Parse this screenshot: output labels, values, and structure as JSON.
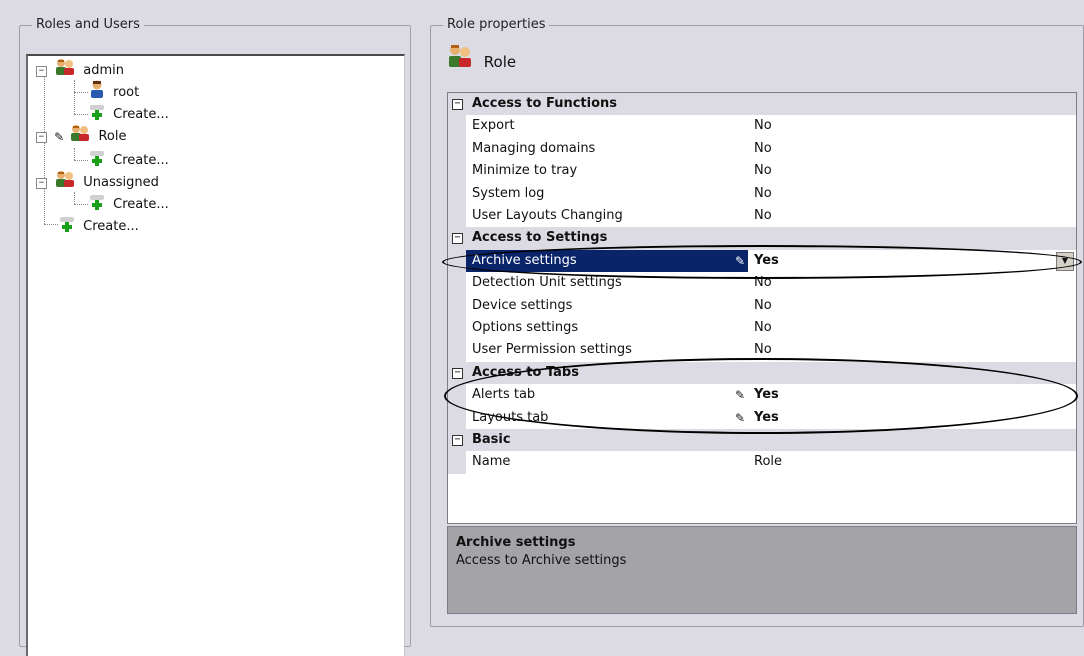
{
  "roles_panel": {
    "title": "Roles and Users",
    "tree": [
      {
        "id": "admin",
        "label": "admin",
        "icon": "users-group-icon",
        "expander": "minus"
      },
      {
        "id": "root",
        "label": "root",
        "icon": "user-icon"
      },
      {
        "id": "admin_create",
        "label": "Create...",
        "icon": "add-user-icon"
      },
      {
        "id": "role",
        "label": "Role",
        "icon": "users-group-icon",
        "expander": "minus",
        "edit_icon": "pencil-icon"
      },
      {
        "id": "role_create",
        "label": "Create...",
        "icon": "add-user-icon"
      },
      {
        "id": "unassigned",
        "label": "Unassigned",
        "icon": "users-group-icon",
        "expander": "minus"
      },
      {
        "id": "unassigned_create",
        "label": "Create...",
        "icon": "add-user-icon"
      },
      {
        "id": "root_create",
        "label": "Create...",
        "icon": "add-user-icon"
      }
    ]
  },
  "props_panel": {
    "title": "Role properties",
    "header": {
      "label": "Role",
      "icon": "users-group-icon"
    },
    "categories": [
      {
        "name": "Access to Functions",
        "items": [
          {
            "name": "Export",
            "value": "No"
          },
          {
            "name": "Managing domains",
            "value": "No"
          },
          {
            "name": "Minimize to tray",
            "value": "No"
          },
          {
            "name": "System log",
            "value": "No"
          },
          {
            "name": "User Layouts Changing",
            "value": "No"
          }
        ]
      },
      {
        "name": "Access to Settings",
        "items": [
          {
            "name": "Archive settings",
            "value": "Yes",
            "modified": true,
            "selected": true
          },
          {
            "name": "Detection Unit settings",
            "value": "No"
          },
          {
            "name": "Device settings",
            "value": "No"
          },
          {
            "name": "Options settings",
            "value": "No"
          },
          {
            "name": "User Permission settings",
            "value": "No"
          }
        ]
      },
      {
        "name": "Access to Tabs",
        "items": [
          {
            "name": "Alerts tab",
            "value": "Yes",
            "modified": true
          },
          {
            "name": "Layouts tab",
            "value": "Yes",
            "modified": true
          }
        ]
      },
      {
        "name": "Basic",
        "items": [
          {
            "name": "Name",
            "value": "Role"
          }
        ]
      }
    ],
    "description": {
      "title": "Archive settings",
      "text": "Access to Archive settings"
    }
  },
  "glyphs": {
    "expander_minus": "−",
    "pencil": "✎",
    "combo_arrow": "▼"
  },
  "colors": {
    "selection": "#0a246a",
    "background": "#dcdbe3",
    "description_bg": "#a4a3a8"
  }
}
